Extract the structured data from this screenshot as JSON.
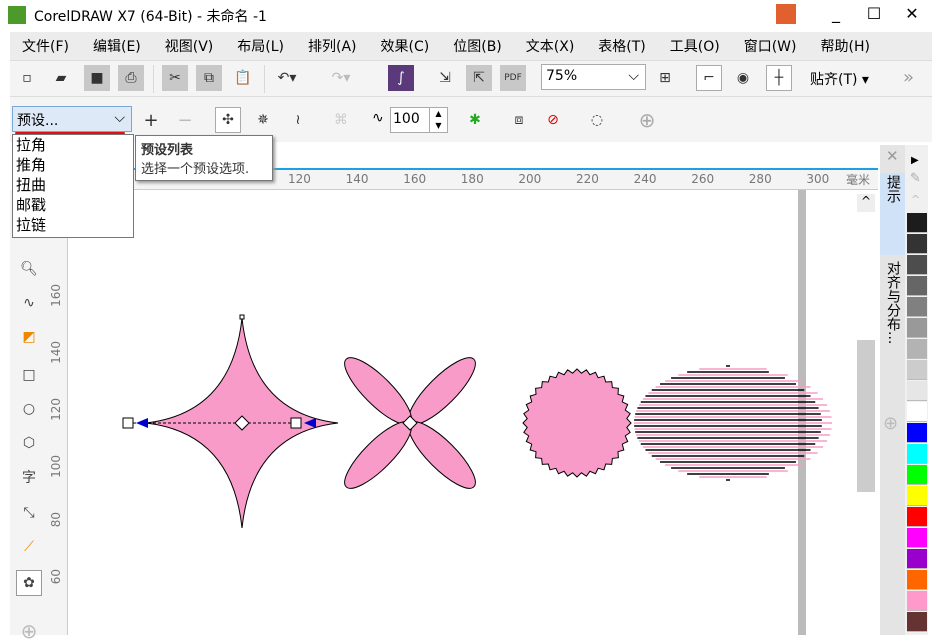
{
  "window": {
    "title": "CorelDRAW X7 (64-Bit) - 未命名 -1"
  },
  "menu": [
    "文件(F)",
    "编辑(E)",
    "视图(V)",
    "布局(L)",
    "排列(A)",
    "效果(C)",
    "位图(B)",
    "文本(X)",
    "表格(T)",
    "工具(O)",
    "窗口(W)",
    "帮助(H)"
  ],
  "toolbar": {
    "zoom": "75%",
    "snap": "贴齐(T)",
    "more": "»"
  },
  "propbar": {
    "preset": "预设...",
    "amplitude": "100"
  },
  "preset_list": [
    "拉角",
    "推角",
    "扭曲",
    "邮戳",
    "拉链"
  ],
  "tooltip": {
    "title": "预设列表",
    "body": "选择一个预设选项."
  },
  "hruler": {
    "labels": [
      "120",
      "140",
      "160",
      "180",
      "200",
      "220",
      "240",
      "260",
      "280",
      "300"
    ],
    "unit": "毫米"
  },
  "vruler": {
    "labels": [
      "160",
      "140",
      "120",
      "100",
      "80",
      "60"
    ]
  },
  "toolbox": {
    "text_tool": "字"
  },
  "dock": {
    "tabs": [
      "提示",
      "对齐与分布..."
    ]
  },
  "palette": [
    "#1c1c1c",
    "#333333",
    "#4d4d4d",
    "#666666",
    "#808080",
    "#999999",
    "#b3b3b3",
    "#cccccc",
    "#e6e6e6",
    "#ffffff",
    "#0000ff",
    "#00ffff",
    "#00ff00",
    "#ffff00",
    "#ff0000",
    "#ff00ff",
    "#9900cc",
    "#ff6600",
    "#ff99cc",
    "#663333"
  ],
  "colors": {
    "shape_fill": "#f99bc8",
    "accent": "#1ba1e2",
    "node_arrow": "#0000cc"
  }
}
